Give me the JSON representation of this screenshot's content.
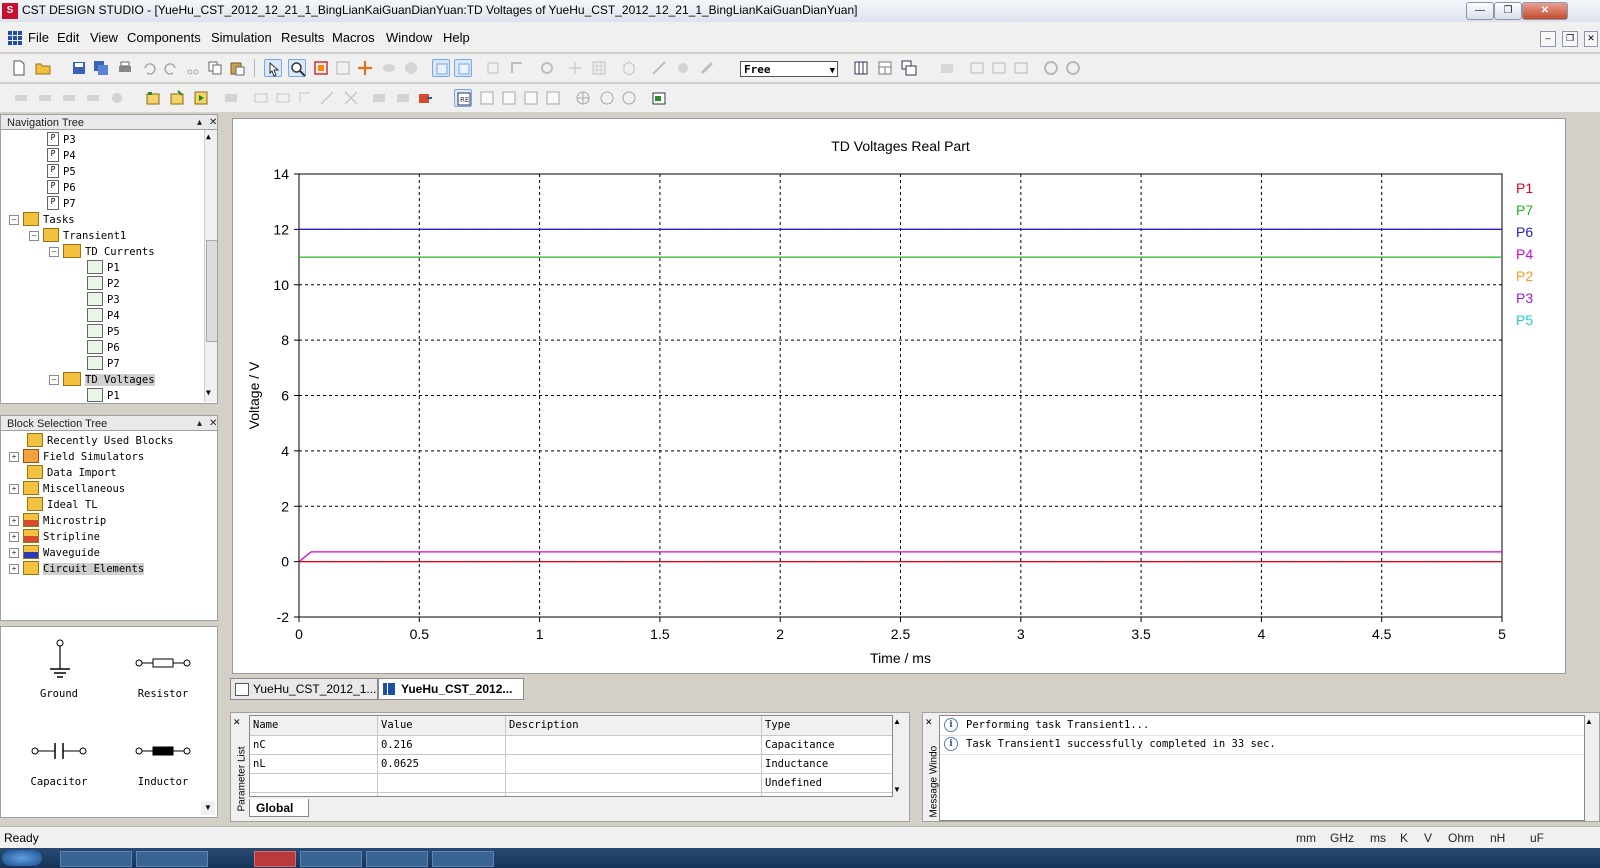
{
  "window": {
    "title": "CST DESIGN STUDIO - [YueHu_CST_2012_12_21_1_BingLianKaiGuanDianYuan:TD Voltages of YueHu_CST_2012_12_21_1_BingLianKaiGuanDianYuan]",
    "logo_text": "S"
  },
  "menu": [
    "File",
    "Edit",
    "View",
    "Components",
    "Simulation",
    "Results",
    "Macros",
    "Window",
    "Help"
  ],
  "toolbar": {
    "mode_select": "Free"
  },
  "navigation_tree": {
    "title": "Navigation Tree",
    "items": [
      {
        "label": "P3"
      },
      {
        "label": "P4"
      },
      {
        "label": "P5"
      },
      {
        "label": "P6"
      },
      {
        "label": "P7"
      },
      {
        "label": "Tasks"
      },
      {
        "label": "Transient1"
      },
      {
        "label": "TD Currents"
      },
      {
        "label": "P1"
      },
      {
        "label": "P2"
      },
      {
        "label": "P3"
      },
      {
        "label": "P4"
      },
      {
        "label": "P5"
      },
      {
        "label": "P6"
      },
      {
        "label": "P7"
      },
      {
        "label": "TD Voltages"
      },
      {
        "label": "P1"
      }
    ]
  },
  "block_tree": {
    "title": "Block Selection Tree",
    "items": [
      {
        "label": "Recently Used Blocks"
      },
      {
        "label": "Field Simulators"
      },
      {
        "label": "Data Import"
      },
      {
        "label": "Miscellaneous"
      },
      {
        "label": "Ideal TL"
      },
      {
        "label": "Microstrip"
      },
      {
        "label": "Stripline"
      },
      {
        "label": "Waveguide"
      },
      {
        "label": "Circuit Elements"
      }
    ]
  },
  "components": [
    {
      "label": "Ground",
      "icon": "ground-icon"
    },
    {
      "label": "Resistor",
      "icon": "resistor-icon"
    },
    {
      "label": "Capacitor",
      "icon": "capacitor-icon"
    },
    {
      "label": "Inductor",
      "icon": "inductor-icon"
    }
  ],
  "chart_data": {
    "type": "line",
    "title": "TD Voltages Real Part",
    "xlabel": "Time / ms",
    "ylabel": "Voltage / V",
    "xlim": [
      0,
      5
    ],
    "ylim": [
      -2,
      14
    ],
    "xticks": [
      0,
      0.5,
      1,
      1.5,
      2,
      2.5,
      3,
      3.5,
      4,
      4.5,
      5
    ],
    "yticks": [
      -2,
      0,
      2,
      4,
      6,
      8,
      10,
      12,
      14
    ],
    "grid": true,
    "legend_position": "right",
    "series": [
      {
        "name": "P1",
        "color": "#e8001c",
        "x": [
          0,
          5
        ],
        "y": [
          0,
          0
        ]
      },
      {
        "name": "P7",
        "color": "#1fb81f",
        "x": [
          0,
          5
        ],
        "y": [
          11,
          11
        ]
      },
      {
        "name": "P6",
        "color": "#2020d8",
        "x": [
          0,
          5
        ],
        "y": [
          12,
          12
        ]
      },
      {
        "name": "P4",
        "color": "#d800d8",
        "x": [
          0,
          0.05,
          5
        ],
        "y": [
          0,
          0.35,
          0.35
        ]
      },
      {
        "name": "P2",
        "color": "#ff9c1a",
        "x": [
          0,
          5
        ],
        "y": [
          0,
          0
        ]
      },
      {
        "name": "P3",
        "color": "#9b1fd8",
        "x": [
          0,
          5
        ],
        "y": [
          12,
          12
        ]
      },
      {
        "name": "P5",
        "color": "#1ad0d0",
        "x": [
          0,
          5
        ],
        "y": [
          0,
          0
        ]
      }
    ]
  },
  "doc_tabs": [
    {
      "label": "YueHu_CST_2012_1..."
    },
    {
      "label": "YueHu_CST_2012..."
    }
  ],
  "parameter_list": {
    "side_title": "Parameter List",
    "columns": [
      "Name",
      "Value",
      "Description",
      "Type"
    ],
    "rows": [
      {
        "name": "nC",
        "value": "0.216",
        "description": "",
        "type": "Capacitance"
      },
      {
        "name": "nL",
        "value": "0.0625",
        "description": "",
        "type": "Inductance"
      },
      {
        "name": "",
        "value": "",
        "description": "",
        "type": "Undefined"
      }
    ],
    "tab": "Global"
  },
  "messages": {
    "side_title": "Message Windo",
    "items": [
      "Performing task Transient1...",
      "Task Transient1 successfully completed in 33 sec."
    ]
  },
  "status": {
    "text": "Ready",
    "units": [
      "mm",
      "GHz",
      "ms",
      "K",
      "V",
      "Ohm",
      "nH",
      "uF"
    ]
  }
}
